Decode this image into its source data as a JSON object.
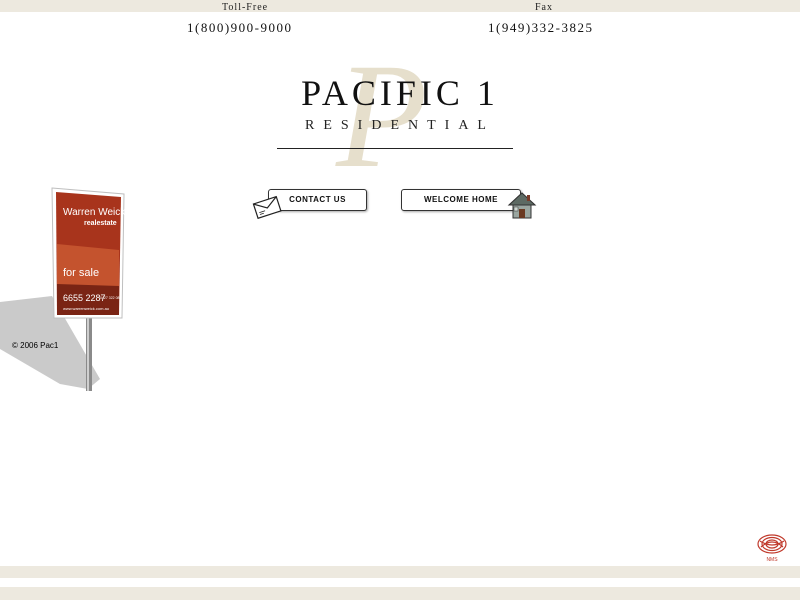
{
  "header": {
    "toll_free_label": "Toll-Free",
    "toll_free_number": "1(800)900-9000",
    "fax_label": "Fax",
    "fax_number": "1(949)332-3825"
  },
  "brand": {
    "title": "PACIFIC 1",
    "subtitle": "RESIDENTIAL",
    "monogram_letter": "P",
    "monogram_color": "#e6dfcc"
  },
  "nav": {
    "contact_label": "CONTACT US",
    "welcome_label": "WELCOME HOME"
  },
  "sign": {
    "agent_name": "Warren Weick",
    "brand": "realestate",
    "status": "for sale",
    "phone": "6655 2287",
    "mobile": "0427 322 088",
    "website": "www.warrenweick.com.au",
    "panel_color": "#a8341c"
  },
  "footer": {
    "copyright": "© 2006 Pac1",
    "logo_text": "NMS",
    "logo_color": "#c0392b"
  }
}
